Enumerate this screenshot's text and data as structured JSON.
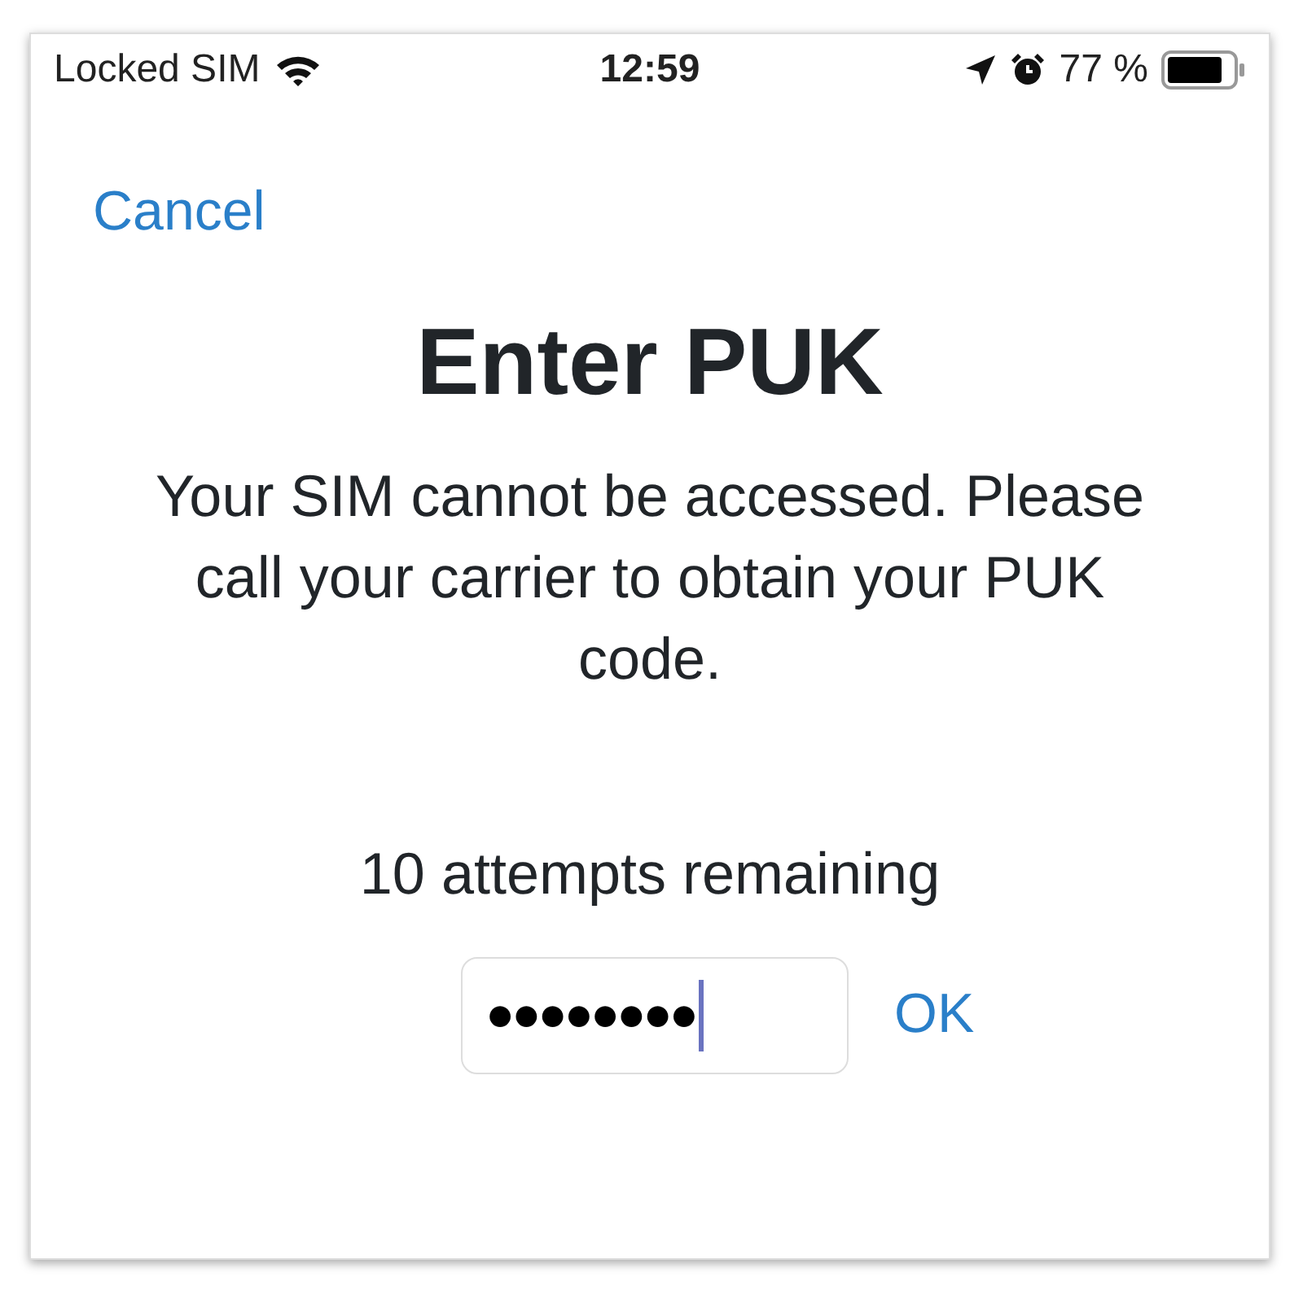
{
  "status_bar": {
    "carrier": "Locked SIM",
    "time": "12:59",
    "battery_percent": "77 %"
  },
  "cancel": "Cancel",
  "title": "Enter PUK",
  "message": "Your SIM cannot be accessed. Please call your carrier to obtain your PUK code.",
  "attempts": "10 attempts remaining",
  "puk_field": {
    "value": "●●●●●●●●"
  },
  "ok": "OK"
}
